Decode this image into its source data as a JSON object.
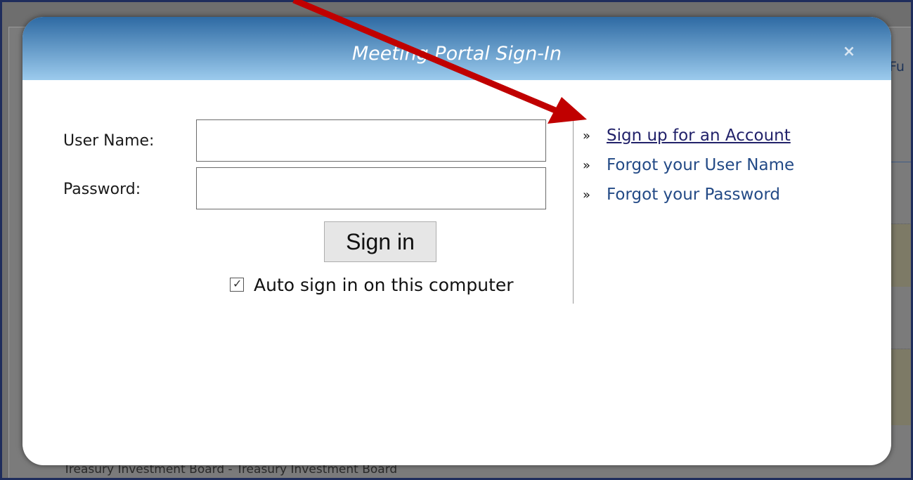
{
  "background": {
    "tab_fragment": "Fu",
    "footer_text": "Treasury Investment Board - Treasury Investment Board"
  },
  "modal": {
    "title": "Meeting Portal Sign-In",
    "close_label": "×",
    "form": {
      "username_label": "User Name:",
      "username_value": "",
      "password_label": "Password:",
      "password_value": "",
      "submit_label": "Sign in",
      "auto_signin_label": "Auto sign in on this computer",
      "auto_signin_checked": true
    },
    "links": [
      {
        "label": "Sign up for an Account",
        "icon": "double-chevron-right-icon"
      },
      {
        "label": "Forgot your User Name",
        "icon": "double-chevron-right-icon"
      },
      {
        "label": "Forgot your Password",
        "icon": "double-chevron-right-icon"
      }
    ]
  },
  "annotation": {
    "arrow_color": "#c00000",
    "target": "Sign up for an Account"
  },
  "colors": {
    "header_gradient_top": "#2e6aa3",
    "header_gradient_bottom": "#9ccbed",
    "link": "#234a86",
    "link_visited": "#22226a"
  }
}
